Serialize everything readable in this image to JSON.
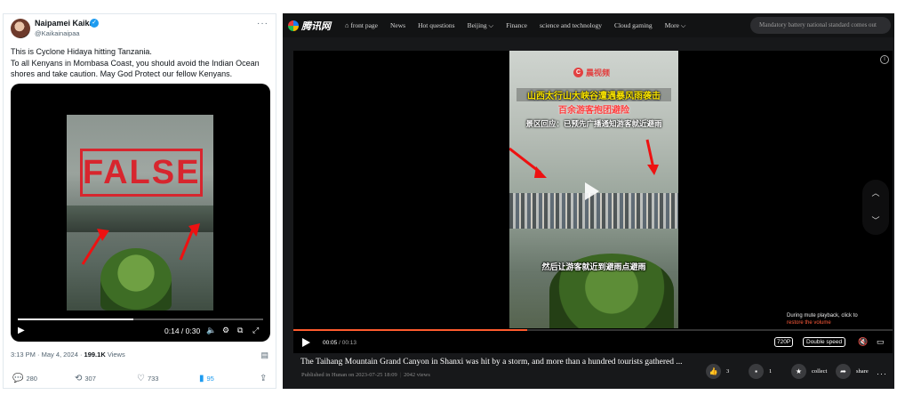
{
  "tweet": {
    "author_name": "Naipamei Kaikai",
    "handle": "@Kaikainaipaa",
    "more": "···",
    "text_line1": "This is Cyclone Hidaya hitting Tanzania.",
    "text_line2": "To all Kenyans in Mombasa Coast, you should avoid the Indian Ocean shores and take caution. May God Protect our fellow Kenyans.",
    "stamp_text": "FALSE",
    "video_time": "0:14 / 0:30",
    "video_progress": 0.47,
    "date": "3:13 PM · May 4, 2024 · ",
    "views_count": "199.1K",
    "views_label": " Views",
    "actions": {
      "replies": "280",
      "reposts": "307",
      "likes": "733",
      "bookmarks": "95"
    }
  },
  "tencent": {
    "logo": "腾讯网",
    "nav": [
      "front page",
      "News",
      "Hot questions",
      "Beijing ⌵",
      "Finance",
      "science and technology",
      "Cloud gaming",
      "More ⌵"
    ],
    "search_placeholder": "Mandatory battery national standard comes out",
    "video": {
      "source_badge": "晨视频",
      "caption_yellow": "山西太行山大峡谷遭遇暴风雨袭击",
      "caption_red": "百余游客抱团避险",
      "caption_white": "景区回应：已预先广播通知游客就近避雨",
      "caption_bottom": "然后让游客就近到避雨点避雨",
      "mute_note": "During mute playback, click to",
      "mute_restore": "restore the volume",
      "time_current": "00:05",
      "time_total": " / 00:13",
      "progress": 0.39,
      "quality": "720P",
      "speed": "Double speed"
    },
    "title": "The Taihang Mountain Grand Canyon in Shanxi was hit by a storm, and more than a hundred tourists gathered ...",
    "published": "Published in Hunan on 2023-07-25 18:09",
    "views": "2042 views",
    "likes": "3",
    "comments": "1",
    "collect_label": "collect",
    "share_label": "share"
  },
  "colors": {
    "twitter_blue": "#1d9bf0",
    "false_red": "#d7262e",
    "tencent_progress": "#ff5b2e",
    "tencent_bg": "#17181a"
  },
  "icons": [
    "verified-icon",
    "play-icon",
    "volume-icon",
    "settings-icon",
    "pip-icon",
    "fullscreen-icon",
    "reply-icon",
    "repost-icon",
    "like-icon",
    "bookmark-icon",
    "share-icon",
    "info-icon",
    "chevron-up-icon",
    "chevron-down-icon",
    "like-thumb-icon",
    "comment-icon",
    "star-icon",
    "share-arrow-icon"
  ]
}
